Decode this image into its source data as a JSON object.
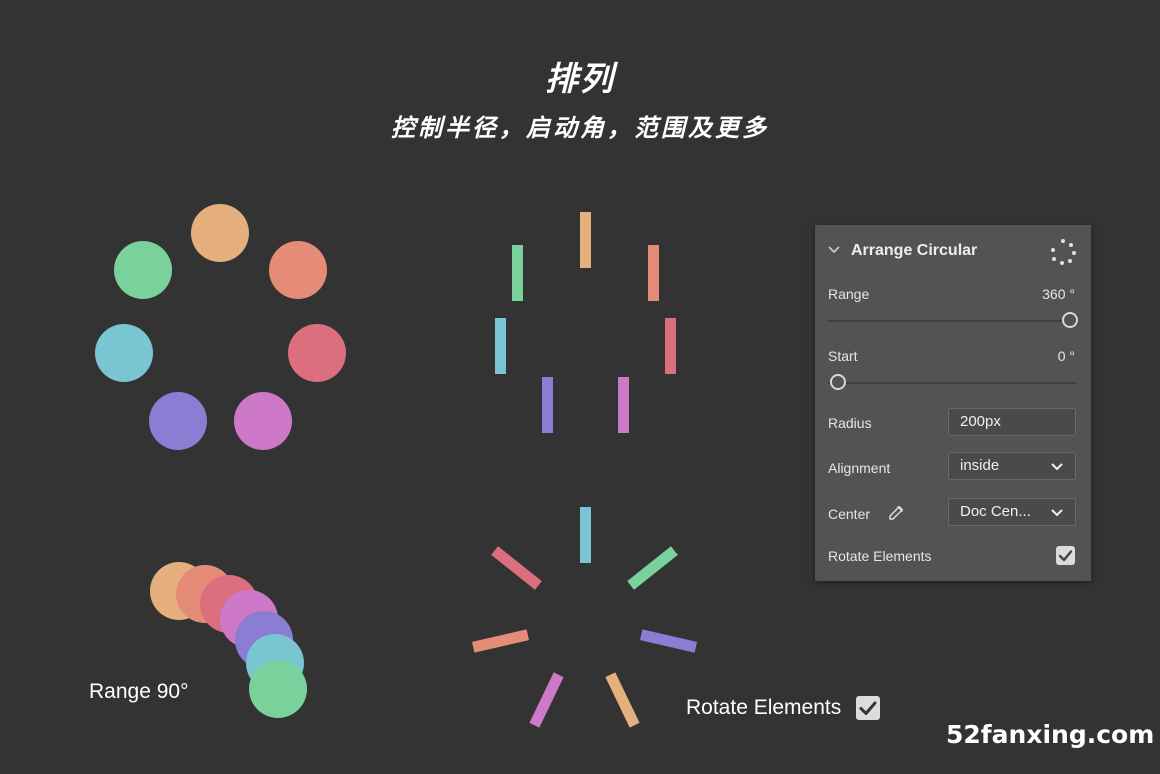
{
  "header": {
    "title": "排列",
    "subtitle": "控制半径，启动角，范围及更多"
  },
  "captions": {
    "range": "Range 90°",
    "rotate": "Rotate Elements"
  },
  "watermark": "52fanxing.com",
  "palette": {
    "orange": "#E5B07E",
    "salmon": "#E58C78",
    "red": "#DC6F7D",
    "magenta": "#CE79C8",
    "purple": "#8A7DD3",
    "cyan": "#79C5D2",
    "green": "#79D29C"
  },
  "panel": {
    "title": "Arrange Circular",
    "collapse_icon": "chevron-down-icon",
    "arrange_icon": "circular-dots-icon",
    "range_label": "Range",
    "range_value": "360 °",
    "range_fraction": 1.0,
    "start_label": "Start",
    "start_value": "0 °",
    "start_fraction": 0.0,
    "radius_label": "Radius",
    "radius_value": "200px",
    "alignment_label": "Alignment",
    "alignment_value": "inside",
    "center_label": "Center",
    "center_value": "Doc Cen...",
    "rotate_label": "Rotate Elements",
    "rotate_checked": true
  }
}
